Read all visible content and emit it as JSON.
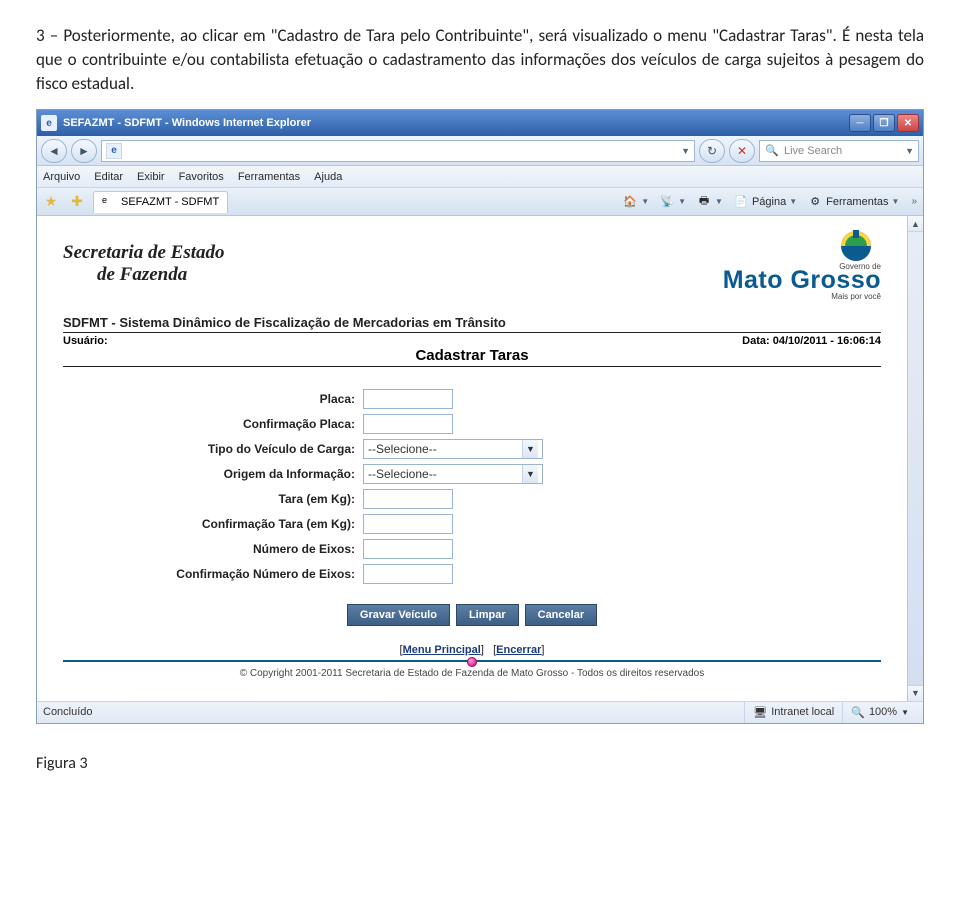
{
  "intro": "3 – Posteriormente, ao clicar em \"Cadastro de Tara pelo Contribuinte\", será visualizado o menu \"Cadastrar Taras\". É nesta tela que o contribuinte e/ou contabilista efetuação o cadastramento das informações dos veículos de carga sujeitos à pesagem do fisco estadual.",
  "window": {
    "title": "SEFAZMT - SDFMT - Windows Internet Explorer",
    "url": "",
    "search_placeholder": "Live Search",
    "menu": {
      "arquivo": "Arquivo",
      "editar": "Editar",
      "exibir": "Exibir",
      "favoritos": "Favoritos",
      "ferramentas": "Ferramentas",
      "ajuda": "Ajuda"
    },
    "tab": "SEFAZMT - SDFMT",
    "tools": {
      "pagina": "Página",
      "ferramentas": "Ferramentas"
    },
    "status": {
      "done": "Concluído",
      "zone": "Intranet local",
      "zoom": "100%"
    }
  },
  "header": {
    "sef1": "Secretaria de Estado",
    "sef2": "de Fazenda",
    "gov": "Governo de",
    "brand": "Mato Grosso",
    "slogan": "Mais por você"
  },
  "system": {
    "title": "SDFMT - Sistema Dinâmico de Fiscalização de Mercadorias em Trânsito",
    "usuario_label": "Usuário:",
    "data_label": "Data: 04/10/2011 - 16:06:14",
    "form_title": "Cadastrar Taras"
  },
  "form": {
    "placa": "Placa:",
    "conf_placa": "Confirmação Placa:",
    "tipo_veic": "Tipo do Veículo de Carga:",
    "origem": "Origem da Informação:",
    "tara": "Tara (em Kg):",
    "conf_tara": "Confirmação Tara (em Kg):",
    "eixos": "Número de Eixos:",
    "conf_eixos": "Confirmação Número de Eixos:",
    "select_default": "--Selecione--"
  },
  "buttons": {
    "gravar": "Gravar Veículo",
    "limpar": "Limpar",
    "cancelar": "Cancelar"
  },
  "footer": {
    "menu_principal": "Menu Principal",
    "encerrar": "Encerrar",
    "copyright": "© Copyright 2001-2011 Secretaria de Estado de Fazenda de Mato Grosso - Todos os direitos reservados"
  },
  "figure_label": "Figura 3"
}
